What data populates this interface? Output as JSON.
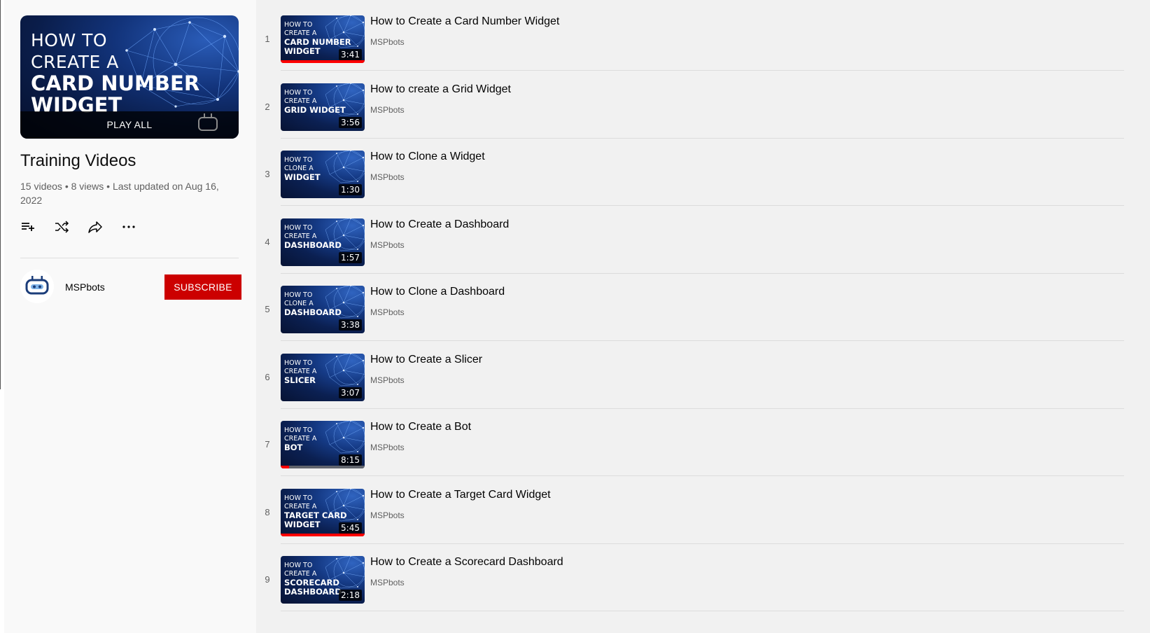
{
  "playlist": {
    "hero": {
      "line1": "HOW TO",
      "line2": "CREATE A",
      "line3": "CARD NUMBER",
      "line4": "WIDGET",
      "play_all": "PLAY ALL"
    },
    "title": "Training Videos",
    "meta": "15 videos • 8 views • Last updated on Aug 16, 2022",
    "actions": [
      "add-to-queue-icon",
      "shuffle-icon",
      "share-icon",
      "more-icon"
    ],
    "owner": {
      "name": "MSPbots",
      "subscribe_label": "SUBSCRIBE"
    }
  },
  "colors": {
    "accent": "#cc0000",
    "progress": "#ff0000",
    "background": "#f1f1f1",
    "sidebar": "#f9f9f9"
  },
  "videos": [
    {
      "index": "1",
      "thumb_small": [
        "HOW TO",
        "CREATE A"
      ],
      "thumb_big": [
        "CARD NUMBER",
        "WIDGET"
      ],
      "duration": "3:41",
      "title": "How to Create a Card Number Widget",
      "channel": "MSPbots",
      "watched": 1.0
    },
    {
      "index": "2",
      "thumb_small": [
        "HOW TO",
        "CREATE A"
      ],
      "thumb_big": [
        "GRID WIDGET"
      ],
      "duration": "3:56",
      "title": "How to create a Grid Widget",
      "channel": "MSPbots",
      "watched": 0
    },
    {
      "index": "3",
      "thumb_small": [
        "HOW TO",
        "CLONE A"
      ],
      "thumb_big": [
        "WIDGET"
      ],
      "duration": "1:30",
      "title": "How to Clone a Widget",
      "channel": "MSPbots",
      "watched": 0
    },
    {
      "index": "4",
      "thumb_small": [
        "HOW TO",
        "CREATE A"
      ],
      "thumb_big": [
        "DASHBOARD"
      ],
      "duration": "1:57",
      "title": "How to Create a Dashboard",
      "channel": "MSPbots",
      "watched": 0
    },
    {
      "index": "5",
      "thumb_small": [
        "HOW TO",
        "CLONE A"
      ],
      "thumb_big": [
        "DASHBOARD"
      ],
      "duration": "3:38",
      "title": "How to Clone a Dashboard",
      "channel": "MSPbots",
      "watched": 0
    },
    {
      "index": "6",
      "thumb_small": [
        "HOW TO",
        "CREATE A"
      ],
      "thumb_big": [
        "SLICER"
      ],
      "duration": "3:07",
      "title": "How to Create a Slicer",
      "channel": "MSPbots",
      "watched": 0
    },
    {
      "index": "7",
      "thumb_small": [
        "HOW TO",
        "CREATE A"
      ],
      "thumb_big": [
        "BOT"
      ],
      "duration": "8:15",
      "title": "How to Create a Bot",
      "channel": "MSPbots",
      "watched": 0.1
    },
    {
      "index": "8",
      "thumb_small": [
        "HOW TO",
        "CREATE A"
      ],
      "thumb_big": [
        "TARGET CARD",
        "WIDGET"
      ],
      "duration": "5:45",
      "title": "How to Create a Target Card Widget",
      "channel": "MSPbots",
      "watched": 1.0
    },
    {
      "index": "9",
      "thumb_small": [
        "HOW TO",
        "CREATE A"
      ],
      "thumb_big": [
        "SCORECARD",
        "DASHBOARD"
      ],
      "duration": "2:18",
      "title": "How to Create a Scorecard Dashboard",
      "channel": "MSPbots",
      "watched": 0
    }
  ]
}
